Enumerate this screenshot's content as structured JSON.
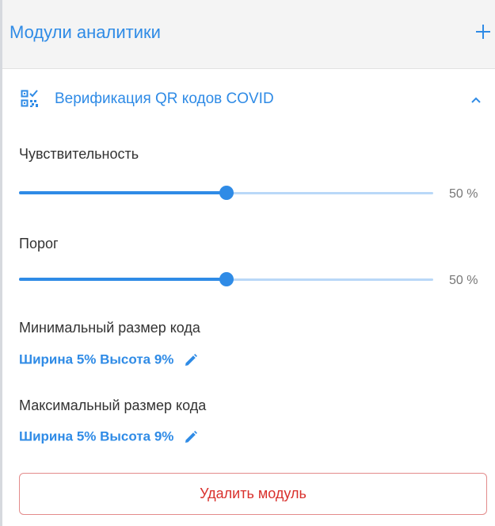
{
  "header": {
    "title": "Модули аналитики",
    "add_icon": "plus-icon"
  },
  "module": {
    "icon": "qr-check-icon",
    "title": "Верификация QR кодов COVID",
    "toggle_icon": "chevron-up-icon",
    "expanded": true
  },
  "sensitivity": {
    "label": "Чувствительность",
    "value": 50,
    "value_text": "50 %"
  },
  "threshold": {
    "label": "Порог",
    "value": 50,
    "value_text": "50 %"
  },
  "min_size": {
    "label": "Минимальный размер кода",
    "link": "Ширина 5% Высота 9%",
    "icon": "pencil-icon"
  },
  "max_size": {
    "label": "Максимальный размер кода",
    "link": "Ширина 5% Высота 9%",
    "icon": "pencil-icon"
  },
  "delete_button": {
    "label": "Удалить модуль"
  },
  "colors": {
    "accent": "#2f8be6",
    "track": "#b9d8f8",
    "header_bg": "#f4f4f4",
    "danger": "#d9302c",
    "danger_border": "#e38b8b"
  }
}
